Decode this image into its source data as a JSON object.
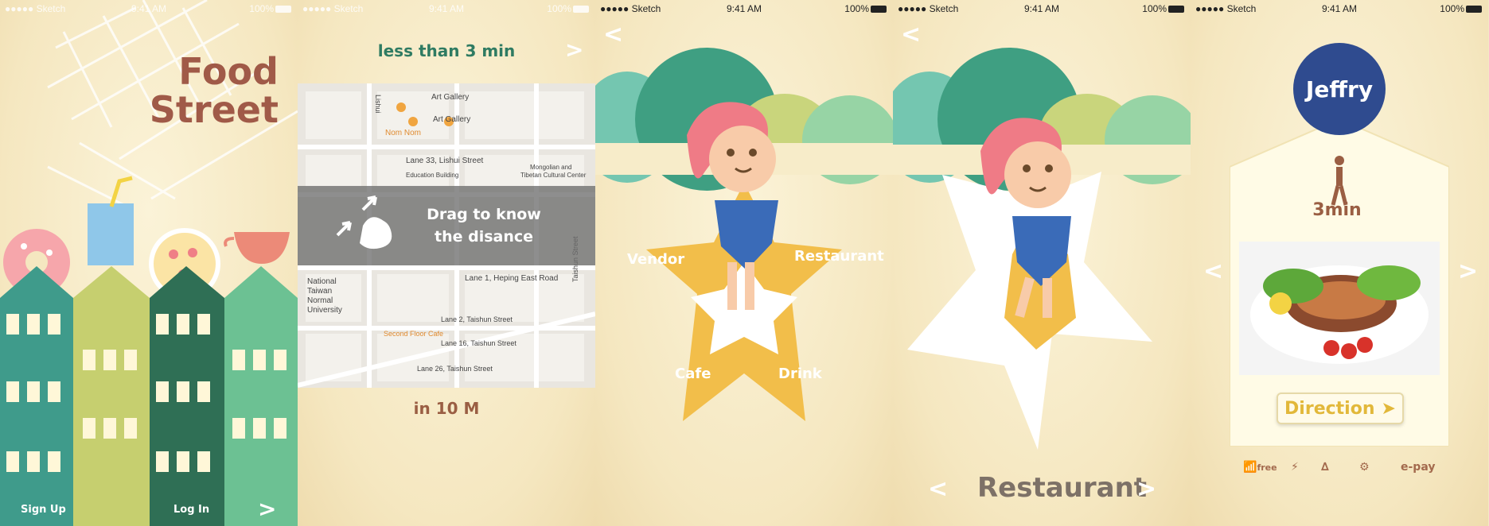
{
  "status_bar": {
    "carrier": "●●●●● Sketch",
    "time": "9:41 AM",
    "battery": "100%"
  },
  "screen1": {
    "title_line1": "Food",
    "title_line2": "Street",
    "sign_up": "Sign Up",
    "log_in": "Log In",
    "next": ">"
  },
  "screen2": {
    "top_label": "less than 3 min",
    "drag_line1": "Drag to know",
    "drag_line2": "the disance",
    "bottom_label": "in 10 M",
    "map_labels": [
      "Art Gallery",
      "Art Gallery",
      "Nom Nom",
      "Lane 33, Lishui Street",
      "Education Building",
      "Mongolian and",
      "Tibetan Cultural Center",
      "National",
      "Taiwan",
      "Normal",
      "University",
      "Lane 2, Taishun Street",
      "Lane 16, Taishun Street",
      "Lane 26, Taishun Street",
      "Lane 1, Heping East Road",
      "Second Floor Cafe",
      "Lishui",
      "Taishun Street"
    ],
    "next": ">"
  },
  "screen3": {
    "labels": {
      "vendor": "Vendor",
      "restaurant": "Restaurant",
      "cafe": "Cafe",
      "drink": "Drink"
    },
    "back": "<"
  },
  "screen4": {
    "selected": "Restaurant",
    "back": "<",
    "prev": "<",
    "next": ">"
  },
  "screen5": {
    "name": "Jeffry",
    "walk_time": "3min",
    "direction": "Direction",
    "prev": "<",
    "next": ">",
    "amenities": [
      "free",
      "e-pay"
    ]
  },
  "colors": {
    "cream": "#f5e7c0",
    "brown": "#a05a48",
    "green": "#2f7b62",
    "teal_building": "#3f9b8b",
    "olive_building": "#c6cf6f",
    "dark_building": "#2f6f55",
    "mint_building": "#6cc193",
    "star_yellow": "#f2be4a",
    "navy": "#2f4b8f"
  }
}
